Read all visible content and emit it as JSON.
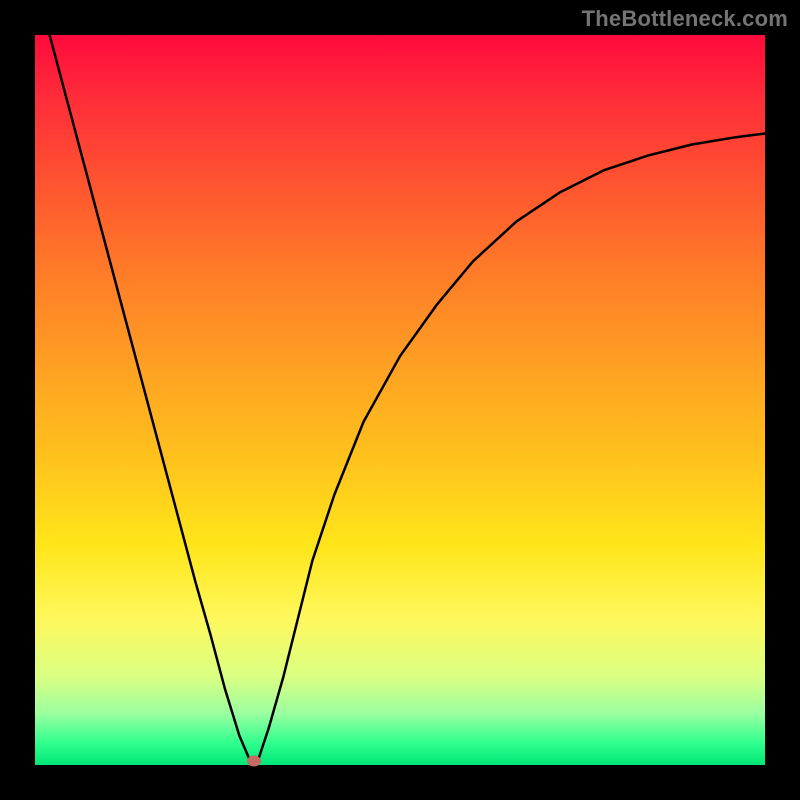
{
  "watermark": "TheBottleneck.com",
  "chart_data": {
    "type": "line",
    "title": "",
    "xlabel": "",
    "ylabel": "",
    "xlim": [
      0,
      100
    ],
    "ylim": [
      0,
      100
    ],
    "series": [
      {
        "name": "bottleneck-curve",
        "x": [
          0,
          2,
          4,
          6,
          8,
          10,
          12,
          14,
          16,
          18,
          20,
          22,
          24,
          26,
          28,
          29.5,
          30.5,
          32,
          34,
          36,
          38,
          41,
          45,
          50,
          55,
          60,
          66,
          72,
          78,
          84,
          90,
          96,
          100
        ],
        "y": [
          107,
          100,
          92.5,
          85,
          77.5,
          70,
          62.5,
          55,
          47.5,
          40,
          32.5,
          25,
          18,
          10.5,
          4,
          0.5,
          0.5,
          5,
          12,
          20,
          28,
          37,
          47,
          56,
          63,
          69,
          74.5,
          78.5,
          81.5,
          83.5,
          85,
          86,
          86.5
        ]
      }
    ],
    "markers": [
      {
        "name": "minimum-point",
        "x": 30,
        "y": 0.5
      }
    ],
    "gradient_colors": {
      "top": "#ff0a3c",
      "bottom": "#00e676"
    }
  }
}
